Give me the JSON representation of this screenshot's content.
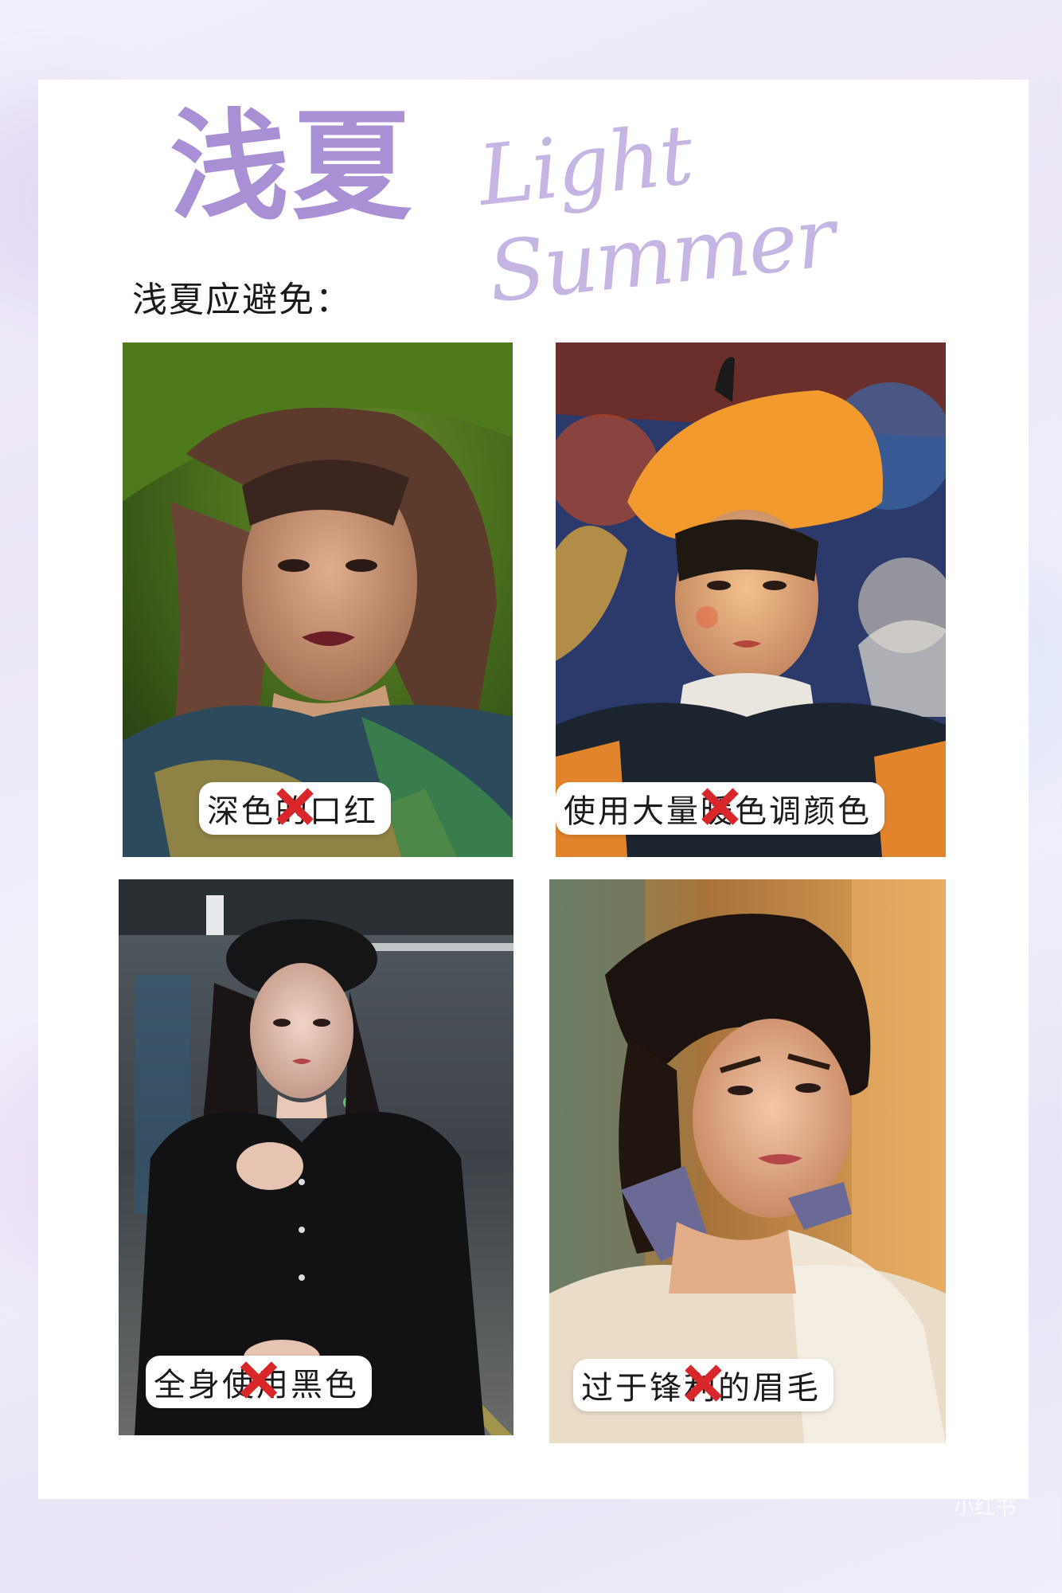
{
  "header": {
    "title_cn": "浅夏",
    "title_en": "Light Summer",
    "subtitle": "浅夏应避免："
  },
  "tiles": [
    {
      "label": "深色的口红",
      "icon": "x-mark-icon"
    },
    {
      "label": "使用大量暖色调颜色",
      "icon": "x-mark-icon"
    },
    {
      "label": "全身使用黑色",
      "icon": "x-mark-icon"
    },
    {
      "label": "过于锋利的眉毛",
      "icon": "x-mark-icon"
    }
  ],
  "watermark": "小红书",
  "colors": {
    "title": "#a98fd4",
    "script": "#c5b5e3",
    "x_mark": "#d8262b"
  }
}
